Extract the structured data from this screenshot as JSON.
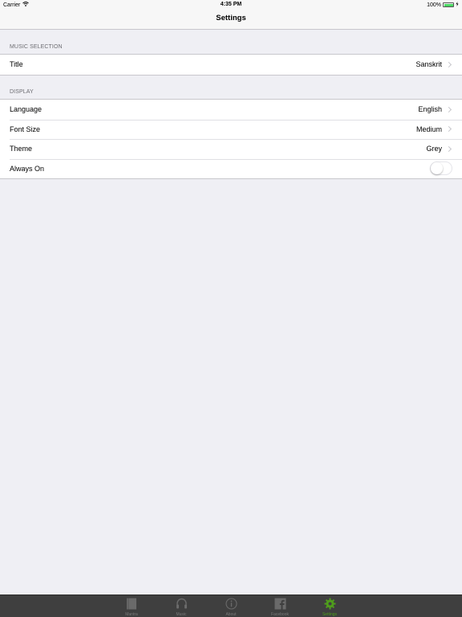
{
  "status_bar": {
    "carrier": "Carrier",
    "time": "4:35 PM",
    "battery": "100%",
    "battery_level": 1.0
  },
  "nav": {
    "title": "Settings"
  },
  "sections": {
    "music": {
      "header": "MUSIC SELECTION",
      "rows": [
        {
          "label": "Title",
          "value": "Sanskrit"
        }
      ]
    },
    "display": {
      "header": "DISPLAY",
      "rows": [
        {
          "label": "Language",
          "value": "English"
        },
        {
          "label": "Font Size",
          "value": "Medium"
        },
        {
          "label": "Theme",
          "value": "Grey"
        },
        {
          "label": "Always On",
          "toggle": false
        }
      ]
    }
  },
  "tabs": [
    {
      "label": "Mantra",
      "icon": "book-icon",
      "active": false
    },
    {
      "label": "Music",
      "icon": "headphones-icon",
      "active": false
    },
    {
      "label": "About",
      "icon": "info-icon",
      "active": false
    },
    {
      "label": "Facebook",
      "icon": "facebook-icon",
      "active": false
    },
    {
      "label": "Settings",
      "icon": "gear-icon",
      "active": true
    }
  ],
  "colors": {
    "background": "#efeff4",
    "tab_bar": "#3f3f3f",
    "tab_active": "#4f9d1c",
    "tab_inactive": "#7a7a7a",
    "battery": "#4cd964"
  }
}
